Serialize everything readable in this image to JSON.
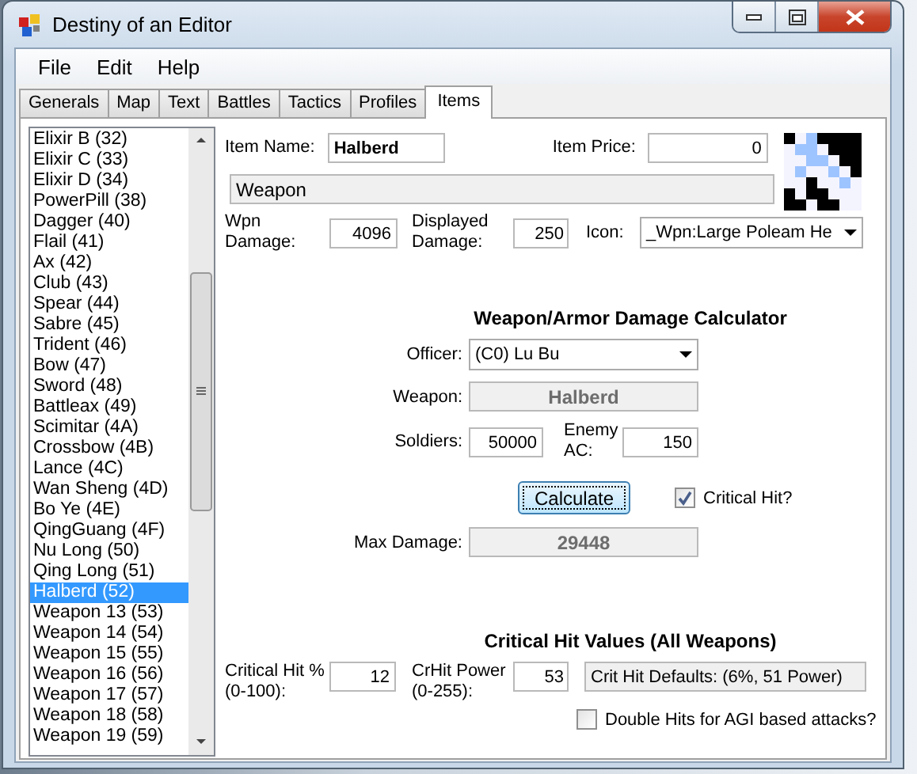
{
  "window": {
    "title": "Destiny of an Editor"
  },
  "menu": [
    "File",
    "Edit",
    "Help"
  ],
  "tabs": [
    {
      "label": "Generals",
      "selected": false
    },
    {
      "label": "Map",
      "selected": false
    },
    {
      "label": "Text",
      "selected": false
    },
    {
      "label": "Battles",
      "selected": false
    },
    {
      "label": "Tactics",
      "selected": false
    },
    {
      "label": "Profiles",
      "selected": false
    },
    {
      "label": "Items",
      "selected": true
    }
  ],
  "items": [
    {
      "label": "Elixir B (32)",
      "selected": false
    },
    {
      "label": "Elixir C (33)",
      "selected": false
    },
    {
      "label": "Elixir D (34)",
      "selected": false
    },
    {
      "label": "PowerPill (38)",
      "selected": false
    },
    {
      "label": "Dagger (40)",
      "selected": false
    },
    {
      "label": "Flail (41)",
      "selected": false
    },
    {
      "label": "Ax (42)",
      "selected": false
    },
    {
      "label": "Club (43)",
      "selected": false
    },
    {
      "label": "Spear (44)",
      "selected": false
    },
    {
      "label": "Sabre (45)",
      "selected": false
    },
    {
      "label": "Trident (46)",
      "selected": false
    },
    {
      "label": "Bow (47)",
      "selected": false
    },
    {
      "label": "Sword (48)",
      "selected": false
    },
    {
      "label": "Battleax (49)",
      "selected": false
    },
    {
      "label": "Scimitar (4A)",
      "selected": false
    },
    {
      "label": "Crossbow (4B)",
      "selected": false
    },
    {
      "label": "Lance (4C)",
      "selected": false
    },
    {
      "label": "Wan Sheng (4D)",
      "selected": false
    },
    {
      "label": "Bo Ye (4E)",
      "selected": false
    },
    {
      "label": "QingGuang (4F)",
      "selected": false
    },
    {
      "label": "Nu Long (50)",
      "selected": false
    },
    {
      "label": "Qing Long (51)",
      "selected": false
    },
    {
      "label": "Halberd (52)",
      "selected": true
    },
    {
      "label": "Weapon 13 (53)",
      "selected": false
    },
    {
      "label": "Weapon 14 (54)",
      "selected": false
    },
    {
      "label": "Weapon 15 (55)",
      "selected": false
    },
    {
      "label": "Weapon 16 (56)",
      "selected": false
    },
    {
      "label": "Weapon 17 (57)",
      "selected": false
    },
    {
      "label": "Weapon 18 (58)",
      "selected": false
    },
    {
      "label": "Weapon 19 (59)",
      "selected": false
    }
  ],
  "item": {
    "name_label": "Item Name:",
    "name": "Halberd",
    "price_label": "Item Price:",
    "price": "0",
    "type": "Weapon",
    "wpn_damage_label": "Wpn Damage:",
    "wpn_damage": "4096",
    "displayed_damage_label": "Displayed Damage:",
    "displayed_damage": "250",
    "icon_label": "Icon:",
    "icon": "_Wpn:Large Poleam He"
  },
  "calculator": {
    "title": "Weapon/Armor Damage Calculator",
    "officer_label": "Officer:",
    "officer": "(C0) Lu Bu",
    "weapon_label": "Weapon:",
    "weapon": "Halberd",
    "soldiers_label": "Soldiers:",
    "soldiers": "50000",
    "enemy_ac_label": "Enemy AC:",
    "enemy_ac": "150",
    "calculate_button": "Calculate",
    "critical_hit": {
      "label": "Critical Hit?",
      "checked": true
    },
    "max_damage_label": "Max Damage:",
    "max_damage": "29448"
  },
  "critical": {
    "title": "Critical Hit Values (All Weapons)",
    "percent_label": "Critical Hit % (0-100):",
    "percent": "12",
    "power_label": "CrHit Power (0-255):",
    "power": "53",
    "defaults": "Crit Hit Defaults: (6%, 51 Power)",
    "double_hits": {
      "label": "Double Hits for AGI based attacks?",
      "checked": false
    }
  }
}
